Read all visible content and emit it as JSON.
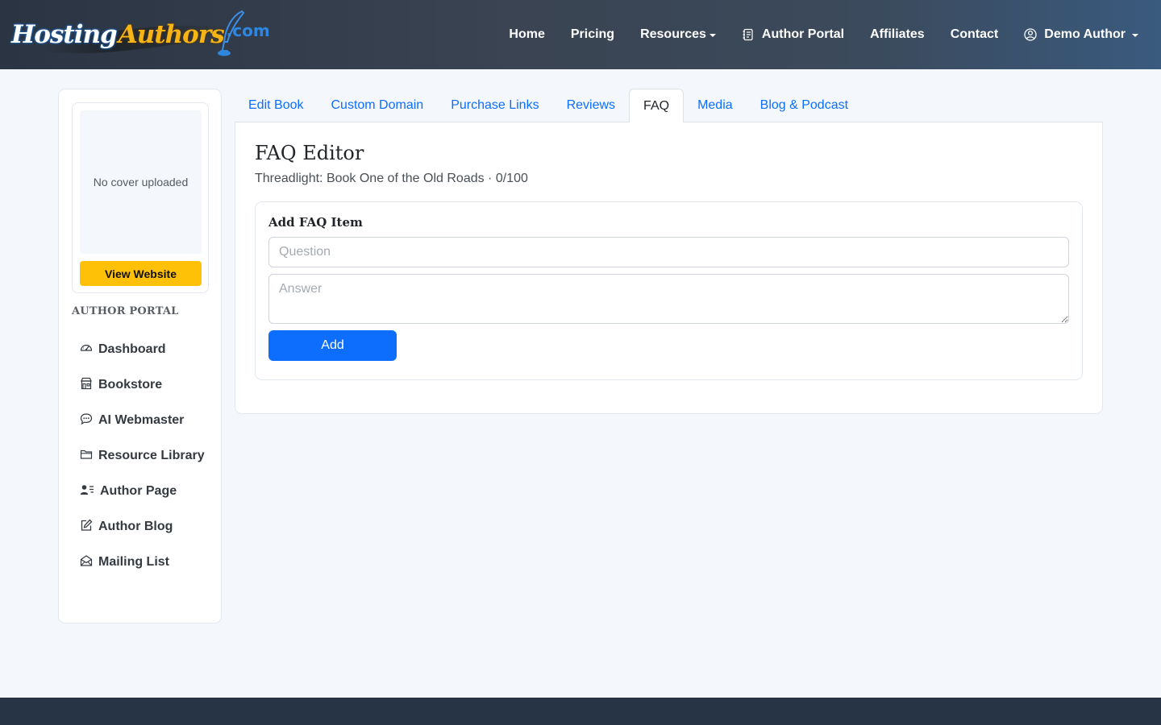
{
  "brand": {
    "part1": "Hosting",
    "part2": "Authors",
    "part3": ".com",
    "logo_icon": "quill-pen-icon"
  },
  "nav": {
    "home": "Home",
    "pricing": "Pricing",
    "resources": "Resources",
    "author_portal": "Author Portal",
    "affiliates": "Affiliates",
    "contact": "Contact",
    "user": "Demo Author"
  },
  "sidebar": {
    "cover_placeholder": "No cover uploaded",
    "view_website": "View Website",
    "heading": "AUTHOR PORTAL",
    "items": [
      {
        "label": "Dashboard",
        "icon": "speedometer-icon"
      },
      {
        "label": "Bookstore",
        "icon": "shop-icon"
      },
      {
        "label": "AI Webmaster",
        "icon": "chat-dots-icon"
      },
      {
        "label": "Resource Library",
        "icon": "folder-icon"
      },
      {
        "label": "Author Page",
        "icon": "person-lines-icon"
      },
      {
        "label": "Author Blog",
        "icon": "pencil-square-icon"
      },
      {
        "label": "Mailing List",
        "icon": "envelope-open-icon"
      }
    ]
  },
  "tabs": [
    {
      "label": "Edit Book",
      "active": false
    },
    {
      "label": "Custom Domain",
      "active": false
    },
    {
      "label": "Purchase Links",
      "active": false
    },
    {
      "label": "Reviews",
      "active": false
    },
    {
      "label": "FAQ",
      "active": true
    },
    {
      "label": "Media",
      "active": false
    },
    {
      "label": "Blog & Podcast",
      "active": false
    }
  ],
  "main": {
    "title": "FAQ Editor",
    "subtitle": "Threadlight: Book One of the Old Roads · 0/100",
    "card_title": "Add FAQ Item",
    "question_placeholder": "Question",
    "question_value": "",
    "answer_placeholder": "Answer",
    "answer_value": "",
    "add_label": "Add"
  },
  "colors": {
    "primary": "#0d6efd",
    "warning": "#ffc107",
    "footer": "#273445",
    "page_bg": "#f4f7fb"
  }
}
